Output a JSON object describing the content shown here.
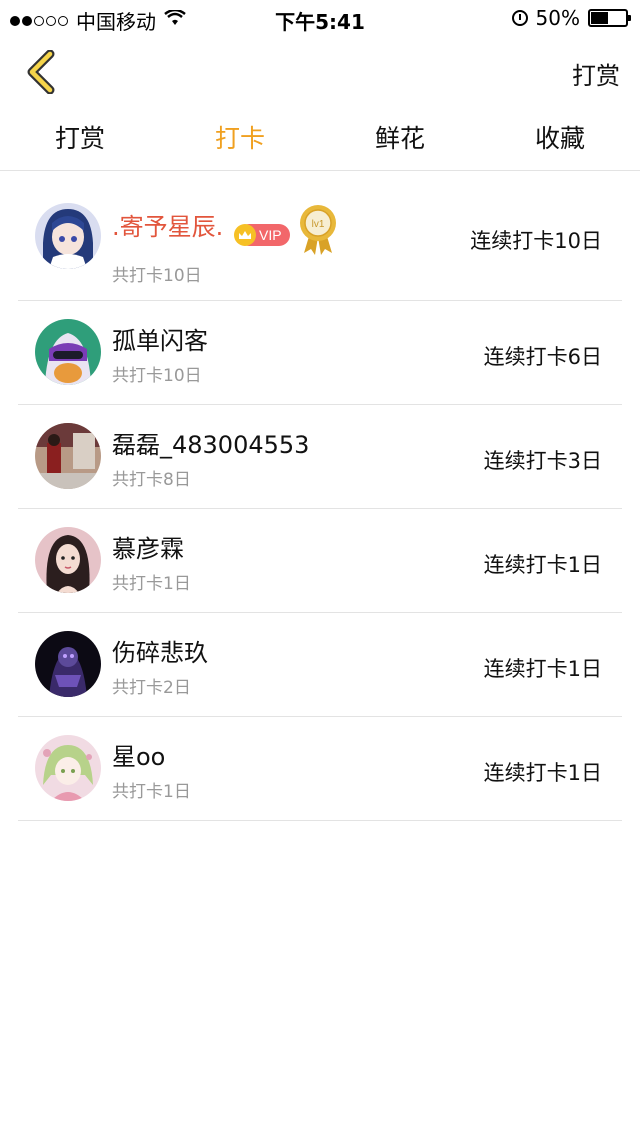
{
  "status_bar": {
    "carrier": "中国移动",
    "time": "下午5:41",
    "battery": "50%",
    "battery_level": 0.5,
    "signal_bars": 2
  },
  "nav": {
    "back_icon": "chevron-left-icon",
    "action_label": "打赏"
  },
  "tabs": [
    {
      "label": "打赏",
      "active": false
    },
    {
      "label": "打卡",
      "active": true
    },
    {
      "label": "鲜花",
      "active": false
    },
    {
      "label": "收藏",
      "active": false
    }
  ],
  "rows": [
    {
      "name": ".寄予星辰.",
      "total": "共打卡10日",
      "streak": "连续打卡10日",
      "vip": "VIP",
      "level": "lv1"
    },
    {
      "name": "孤单闪客",
      "total": "共打卡10日",
      "streak": "连续打卡6日"
    },
    {
      "name": "磊磊_483004553",
      "total": "共打卡8日",
      "streak": "连续打卡3日"
    },
    {
      "name": "慕彦霖",
      "total": "共打卡1日",
      "streak": "连续打卡1日"
    },
    {
      "name": "伤碎悲玖",
      "total": "共打卡2日",
      "streak": "连续打卡1日"
    },
    {
      "name": "星oo",
      "total": "共打卡1日",
      "streak": "连续打卡1日"
    }
  ],
  "colors": {
    "accent": "#f0a020",
    "vip_name": "#e2553c",
    "divider": "#e3e3e3",
    "muted": "#999999"
  }
}
